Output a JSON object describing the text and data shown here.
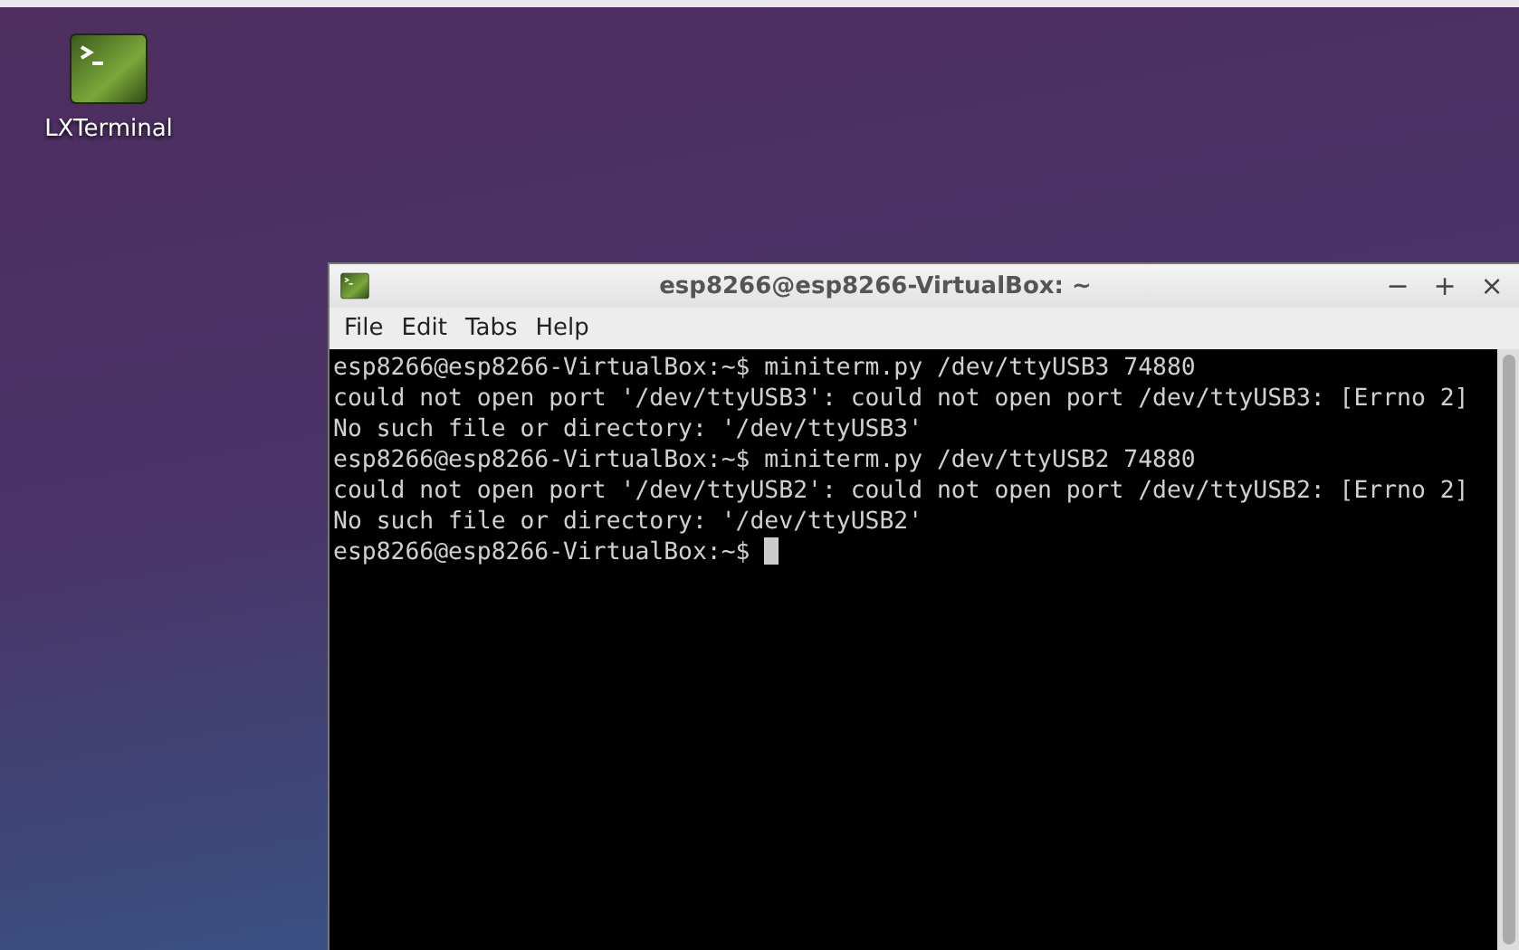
{
  "desktop_icons": [
    {
      "label": "LXTerminal"
    }
  ],
  "window": {
    "title": "esp8266@esp8266-VirtualBox: ~",
    "controls": [
      "−",
      "+",
      "×"
    ],
    "menu": [
      "File",
      "Edit",
      "Tabs",
      "Help"
    ],
    "lines": [
      "esp8266@esp8266-VirtualBox:~$ miniterm.py /dev/ttyUSB3 74880",
      "could not open port '/dev/ttyUSB3': could not open port /dev/ttyUSB3: [Errno 2]",
      "No such file or directory: '/dev/ttyUSB3'",
      "esp8266@esp8266-VirtualBox:~$ miniterm.py /dev/ttyUSB2 74880",
      "could not open port '/dev/ttyUSB2': could not open port /dev/ttyUSB2: [Errno 2]",
      "No such file or directory: '/dev/ttyUSB2'"
    ],
    "prompt": "esp8266@esp8266-VirtualBox:~$",
    "cursor": true
  }
}
